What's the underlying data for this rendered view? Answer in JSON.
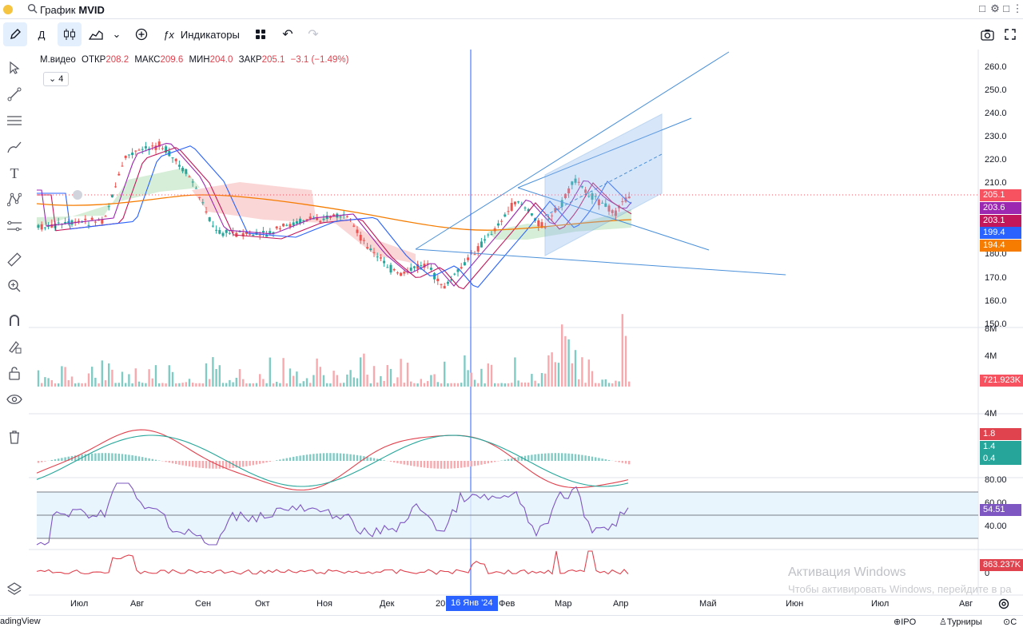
{
  "window": {
    "app_title": "График",
    "symbol": "MVID"
  },
  "toolbar": {
    "timeframe": "Д",
    "indicators_label": "Индикаторы"
  },
  "legend": {
    "name": "М.видео",
    "open_label": "ОТКР",
    "open": "208.2",
    "high_label": "МАКС",
    "high": "209.6",
    "low_label": "МИН",
    "low": "204.0",
    "close_label": "ЗАКР",
    "close": "205.1",
    "change": "−3.1 (−1.49%)",
    "collapsed_count": "4"
  },
  "price_axis": {
    "ticks": [
      "260.0",
      "250.0",
      "240.0",
      "230.0",
      "220.0",
      "210.0",
      "180.0",
      "170.0",
      "160.0",
      "150.0"
    ],
    "tags": [
      {
        "value": "205.1",
        "color": "#f7525f"
      },
      {
        "value": "203.6",
        "color": "#9c27b0"
      },
      {
        "value": "203.1",
        "color": "#c2185b"
      },
      {
        "value": "199.4",
        "color": "#2962ff"
      },
      {
        "value": "194.4",
        "color": "#f57c00"
      }
    ]
  },
  "volume_axis": {
    "ticks": [
      "8M",
      "4M"
    ],
    "tag": "721.923K",
    "tag_color": "#f7525f"
  },
  "macd_axis": {
    "ticks": [
      "4M"
    ],
    "tags": [
      {
        "value": "1.8",
        "color": "#e0424e"
      },
      {
        "value": "1.4",
        "color": "#26a69a"
      },
      {
        "value": "0.4",
        "color": "#26a69a"
      }
    ]
  },
  "rsi_axis": {
    "ticks": [
      "80.00",
      "60.00",
      "40.00"
    ],
    "tag": "54.51",
    "tag_color": "#7e57c2"
  },
  "obv_axis": {
    "ticks": [
      "0"
    ],
    "tag": "863.237K",
    "tag_color": "#e0424e"
  },
  "time_axis": {
    "labels": [
      "Июл",
      "Авг",
      "Сен",
      "Окт",
      "Ноя",
      "Дек",
      "20",
      "Фев",
      "Мар",
      "Апр",
      "Май",
      "Июн",
      "Июл",
      "Авг"
    ],
    "crosshair_date": "16 Янв '24"
  },
  "watermark": {
    "title": "Активация Windows",
    "subtitle": "Чтобы активировать Windows, перейдите в ра"
  },
  "bottombar": {
    "left": "adingView",
    "ipo": "IPO",
    "tournaments": "Турниры",
    "last": "С"
  },
  "colors": {
    "up": "#26a69a",
    "down": "#ef5350",
    "accent": "#2962ff"
  }
}
